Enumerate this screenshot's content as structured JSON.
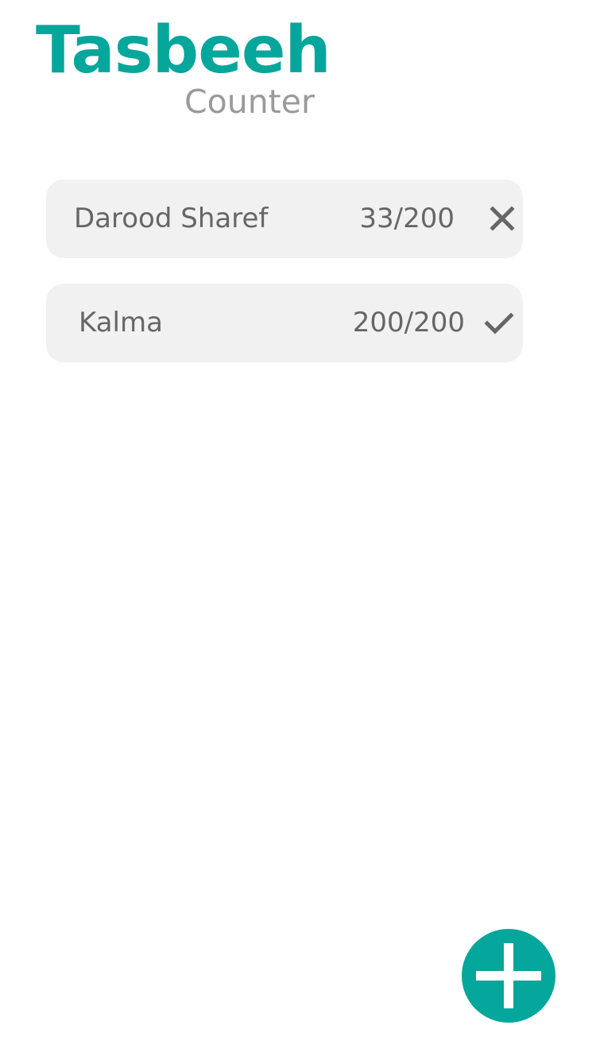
{
  "app": {
    "title": "Tasbeeh",
    "subtitle": "Counter"
  },
  "colors": {
    "brand": "#05a69b",
    "subtitle": "#9a9a9a",
    "item_background": "#f1f1f1",
    "item_text": "#666666",
    "fab_icon": "#ffffff"
  },
  "counters": [
    {
      "name": "Darood Sharef",
      "count": "33/200",
      "status_icon": "close-icon"
    },
    {
      "name": "Kalma",
      "count": "200/200",
      "status_icon": "check-icon"
    }
  ],
  "fab": {
    "icon": "plus-icon"
  }
}
